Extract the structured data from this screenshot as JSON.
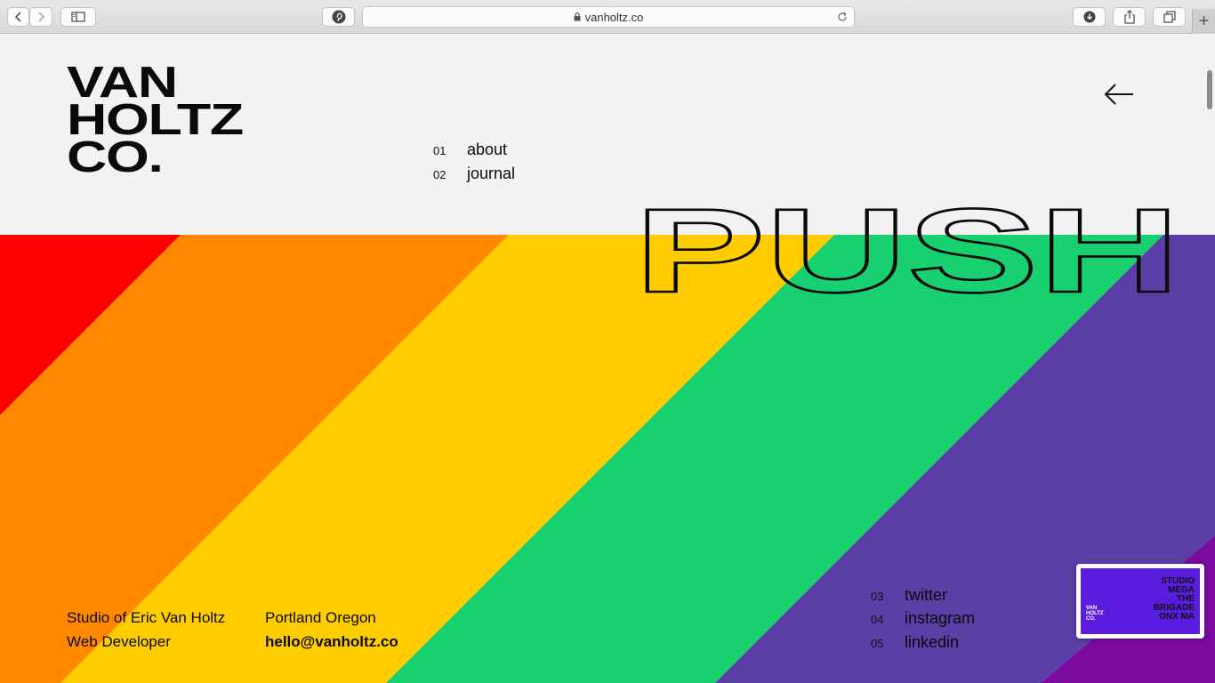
{
  "browser": {
    "url": "vanholtz.co"
  },
  "logo": {
    "lines": [
      "VAN",
      "HOLTZ",
      "CO."
    ]
  },
  "nav": [
    {
      "num": "01",
      "label": "about"
    },
    {
      "num": "02",
      "label": "journal"
    }
  ],
  "hero": {
    "word": "PUSH",
    "stripe_colors": [
      "#ff0000",
      "#ff8800",
      "#ffcc00",
      "#19d071",
      "#5a3fa6",
      "#7a0aa0"
    ]
  },
  "footer": {
    "studio_line": "Studio of Eric Van Holtz",
    "role_line": "Web Developer",
    "location": "Portland Oregon",
    "email": "hello@vanholtz.co"
  },
  "social": [
    {
      "num": "03",
      "label": "twitter"
    },
    {
      "num": "04",
      "label": "instagram"
    },
    {
      "num": "05",
      "label": "linkedin"
    }
  ],
  "thumbnail": {
    "logo_lines": [
      "VAN",
      "HOLTZ",
      "CO."
    ],
    "words": [
      "STUDIO",
      "MEGA",
      "THE",
      "BRIGADE",
      "ONX MA"
    ]
  }
}
